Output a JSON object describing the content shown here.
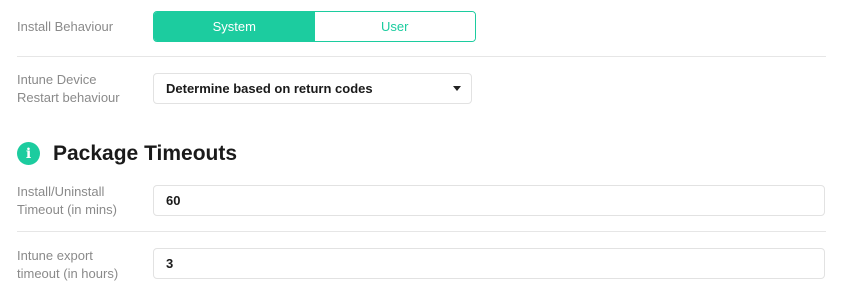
{
  "install_behaviour": {
    "label": "Install Behaviour",
    "options": [
      "System",
      "User"
    ],
    "selected": "System"
  },
  "restart_behaviour": {
    "label_line1": "Intune Device",
    "label_line2": "Restart behaviour",
    "selected_value": "Determine based on return codes"
  },
  "package_timeouts": {
    "icon": "info-icon",
    "icon_glyph": "i",
    "title": "Package Timeouts",
    "install_timeout": {
      "label_line1": "Install/Uninstall",
      "label_line2": "Timeout (in mins)",
      "value": "60"
    },
    "export_timeout": {
      "label_line1": "Intune export",
      "label_line2": "timeout (in hours)",
      "value": "3"
    }
  },
  "colors": {
    "accent": "#1ccc9f",
    "label_text": "#8a8a8a",
    "divider": "#e6e6e6"
  }
}
